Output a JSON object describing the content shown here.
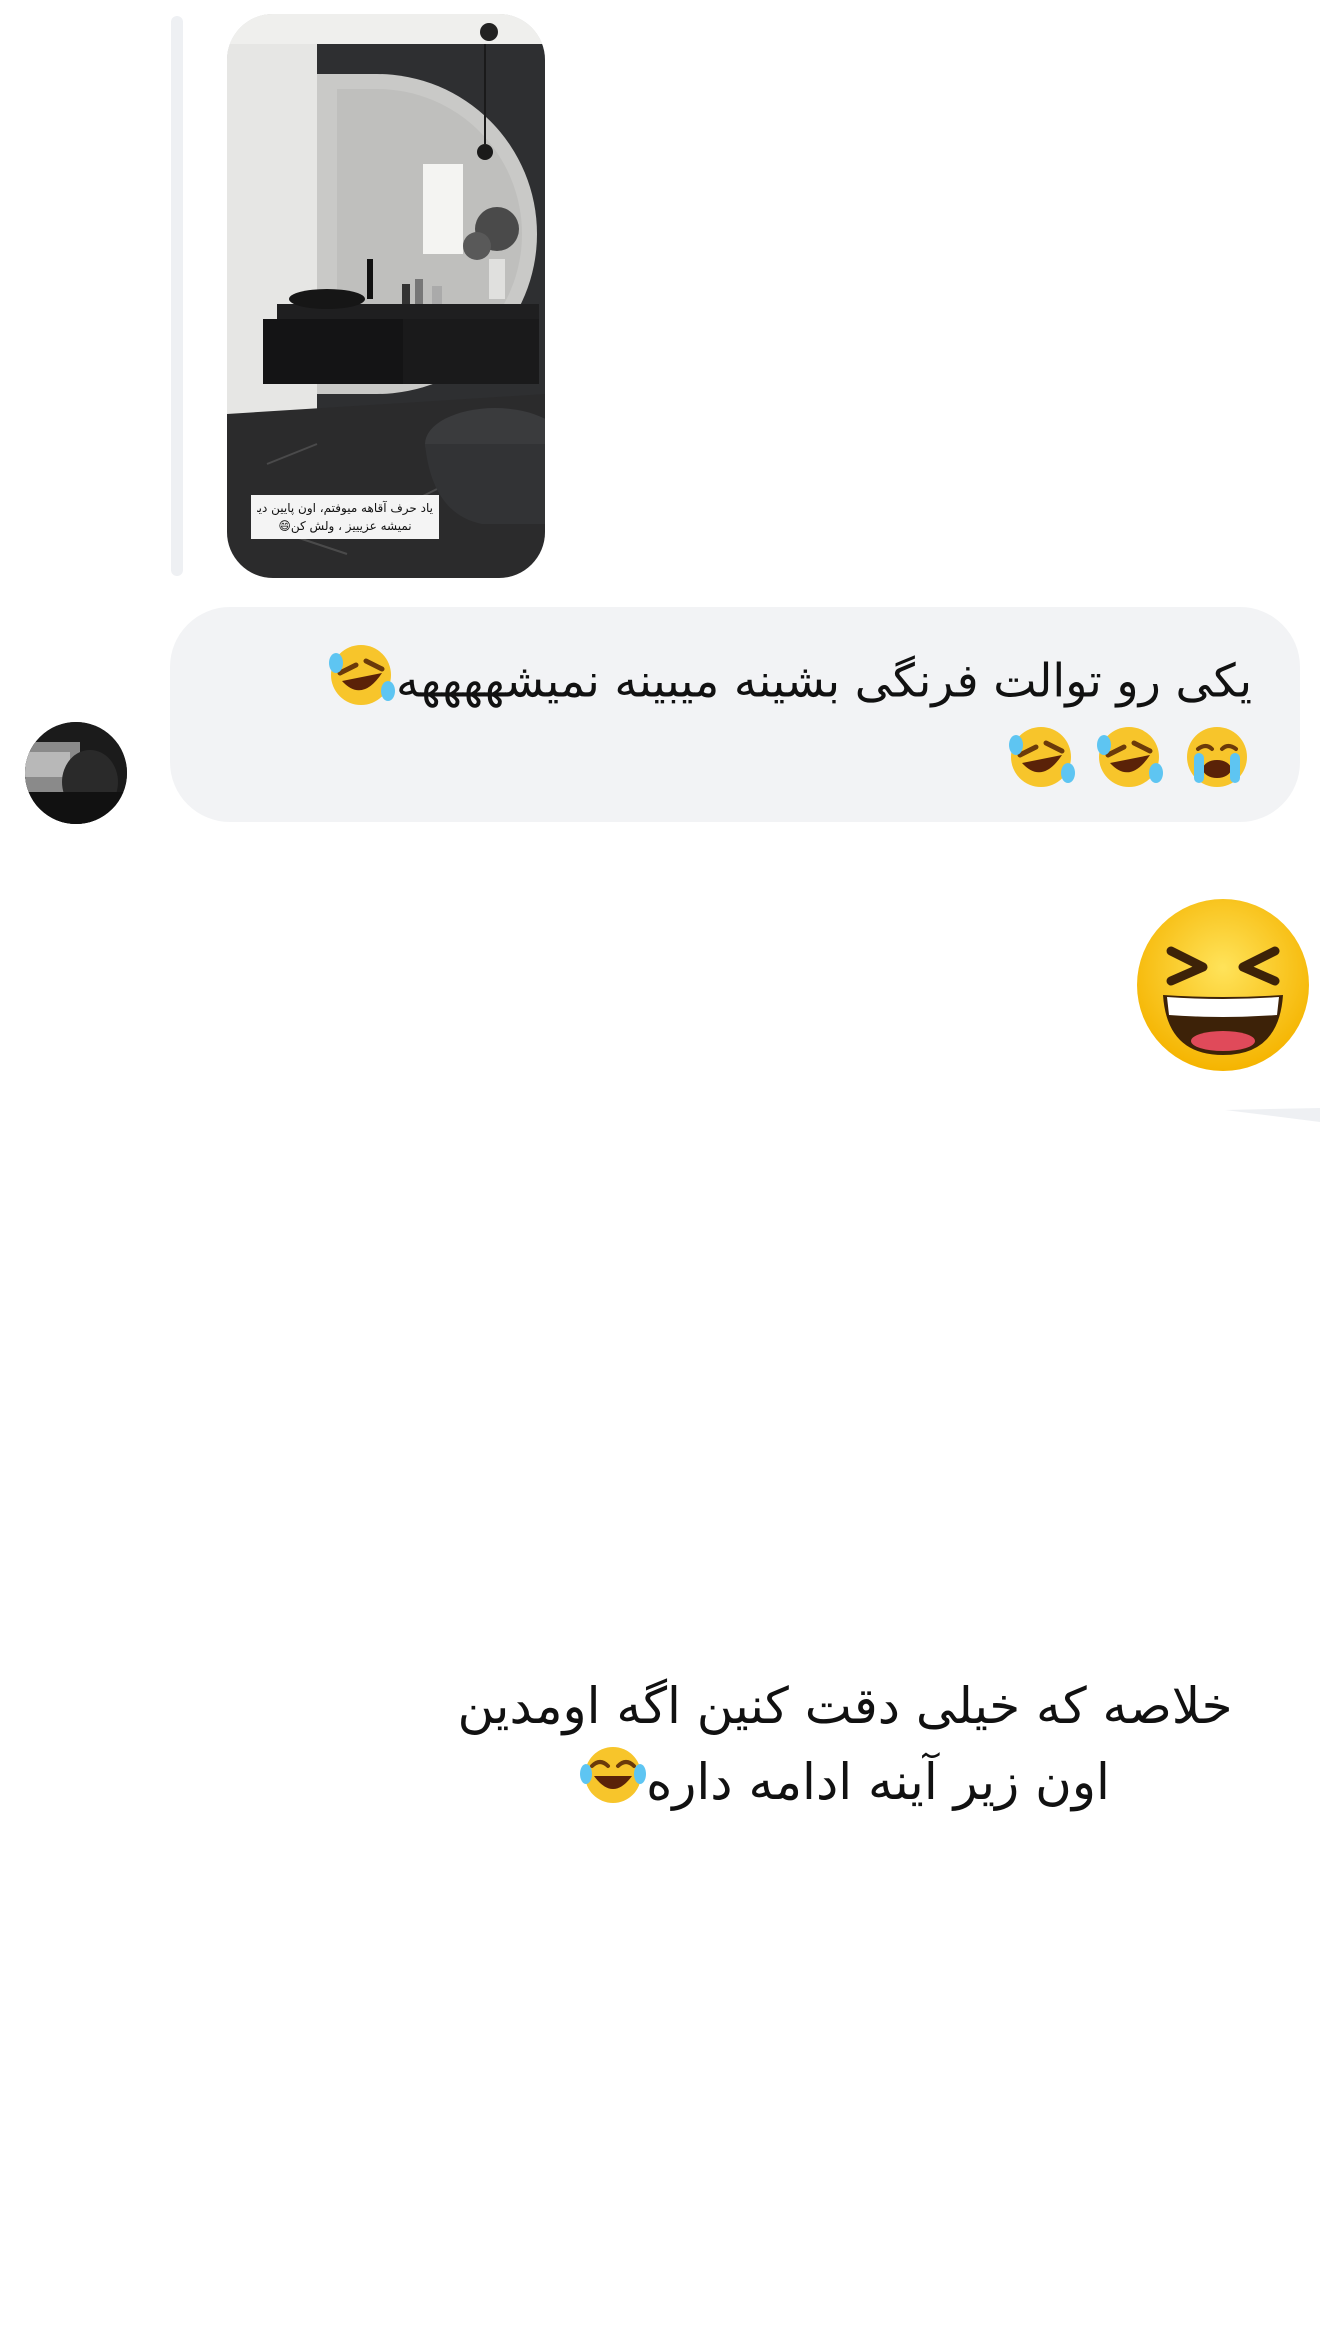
{
  "story_reply": {
    "caption_line1": "یاد حرف آقاهه میوفتم، اون پایین دیده",
    "caption_line2": "نمیشه عزیییز ، ولش کن😄"
  },
  "incoming_message": {
    "line1": "یکی رو توالت فرنگی بشینه میبینه نمیشههههه",
    "line2": "",
    "emojis": [
      "rofl-emoji",
      "rofl-emoji",
      "rofl-emoji",
      "crying-emoji"
    ]
  },
  "outgoing_reaction": {
    "emoji": "grinning-squinting-face-emoji"
  },
  "caption": {
    "line1": "خلاصه که خیلی دقت کنین اگه اومدین",
    "line2": "اون زیر آینه ادامه داره"
  },
  "colors": {
    "bubble": "#f2f3f5",
    "text": "#111111",
    "reply_bar": "#eef0f3",
    "background": "#ffffff"
  }
}
